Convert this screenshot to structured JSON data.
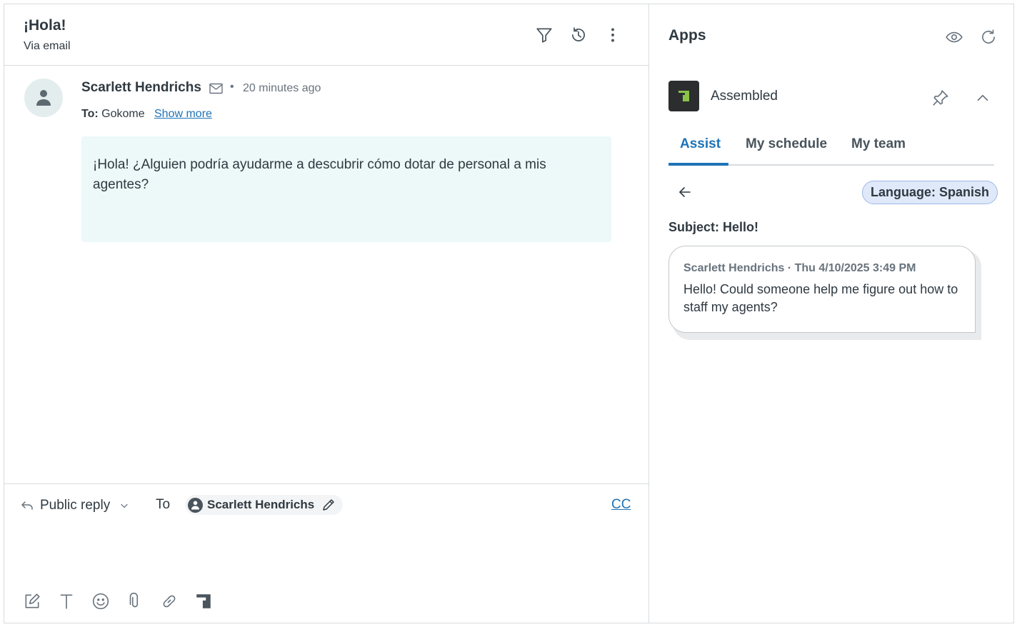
{
  "ticket": {
    "title": "¡Hola!",
    "channel": "Via email",
    "header_icons": [
      "filter-icon",
      "history-icon",
      "more-vertical-icon"
    ]
  },
  "message": {
    "sender": "Scarlett Hendrichs",
    "separator": "•",
    "time": "20 minutes ago",
    "to_label": "To:",
    "to_value": "Gokome",
    "show_more": "Show more",
    "body": "¡Hola! ¿Alguien podría ayudarme a descubrir cómo dotar de personal a mis agentes?"
  },
  "reply": {
    "type_label": "Public reply",
    "to_label": "To",
    "recipient": "Scarlett Hendrichs",
    "cc_label": "CC",
    "tools": [
      "compose-icon",
      "text-format-icon",
      "emoji-icon",
      "attachment-icon",
      "link-icon",
      "assembled-icon"
    ]
  },
  "apps": {
    "title": "Apps",
    "app_name": "Assembled",
    "tabs": [
      {
        "label": "Assist",
        "active": true
      },
      {
        "label": "My schedule",
        "active": false
      },
      {
        "label": "My team",
        "active": false
      }
    ],
    "language_badge": "Language: Spanish",
    "subject": "Subject: Hello!",
    "translation": {
      "meta": "Scarlett Hendrichs · Thu 4/10/2025 3:49 PM",
      "text": "Hello! Could someone help me figure out how to staff my agents?"
    }
  },
  "colors": {
    "accent": "#1f73b7",
    "message_bg": "#edf8f8",
    "badge_bg": "#e0e9f9",
    "logo_bg": "#2b2d2e",
    "logo_mark": "#8bc34a"
  }
}
